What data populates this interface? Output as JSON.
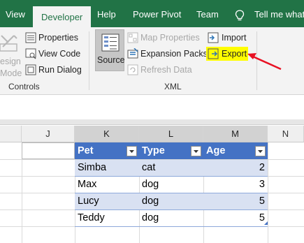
{
  "tabs": [
    {
      "label": "View",
      "active": false
    },
    {
      "label": "Developer",
      "active": true
    },
    {
      "label": "Help",
      "active": false
    },
    {
      "label": "Power Pivot",
      "active": false
    },
    {
      "label": "Team",
      "active": false
    }
  ],
  "tell_me": "Tell me what y",
  "controls_group": {
    "design_mode_line1": "esign",
    "design_mode_line2": "Mode",
    "properties": "Properties",
    "view_code": "View Code",
    "run_dialog": "Run Dialog",
    "label": "Controls"
  },
  "xml_group": {
    "source": "Source",
    "map_properties": "Map Properties",
    "expansion_packs": "Expansion Packs",
    "refresh_data": "Refresh Data",
    "import": "Import",
    "export": "Export",
    "label": "XML"
  },
  "columns": [
    "J",
    "K",
    "L",
    "M",
    "N"
  ],
  "table": {
    "headers": [
      "Pet",
      "Type",
      "Age"
    ],
    "rows": [
      [
        "Simba",
        "cat",
        "2"
      ],
      [
        "Max",
        "dog",
        "3"
      ],
      [
        "Lucy",
        "dog",
        "5"
      ],
      [
        "Teddy",
        "dog",
        "5"
      ]
    ]
  },
  "colors": {
    "ribbon_green": "#217346",
    "table_header": "#4472c4",
    "table_band": "#d9e1f2",
    "highlight": "#fffd00",
    "arrow": "#e81123"
  }
}
